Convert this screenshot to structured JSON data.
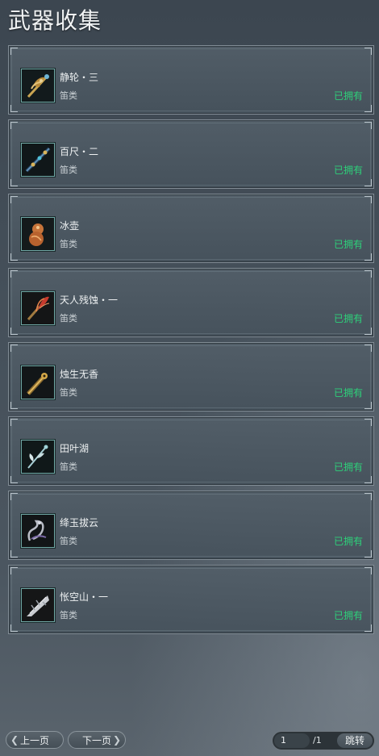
{
  "title": "武器收集",
  "weapons": [
    {
      "name": "静轮・三",
      "type": "笛类",
      "status": "已拥有",
      "icon": "golden-claw-weapon-icon"
    },
    {
      "name": "百尺・二",
      "type": "笛类",
      "status": "已拥有",
      "icon": "jeweled-flute-icon"
    },
    {
      "name": "冰壶",
      "type": "笛类",
      "status": "已拥有",
      "icon": "gourd-flute-icon"
    },
    {
      "name": "天人残蚀・一",
      "type": "笛类",
      "status": "已拥有",
      "icon": "red-feather-flute-icon"
    },
    {
      "name": "烛生无香",
      "type": "笛类",
      "status": "已拥有",
      "icon": "golden-flute-icon"
    },
    {
      "name": "田叶湖",
      "type": "笛类",
      "status": "已拥有",
      "icon": "lotus-flute-icon"
    },
    {
      "name": "绛玉拔云",
      "type": "笛类",
      "status": "已拥有",
      "icon": "dragon-flute-icon"
    },
    {
      "name": "怅空山・一",
      "type": "笛类",
      "status": "已拥有",
      "icon": "silver-blade-flute-icon"
    }
  ],
  "pagination": {
    "prev_label": "上一页",
    "next_label": "下一页",
    "current_page": "1",
    "total_pages": "/1",
    "jump_label": "跳转"
  },
  "colors": {
    "owned": "#2ed07a",
    "icon_border": "#6fa7a4"
  }
}
